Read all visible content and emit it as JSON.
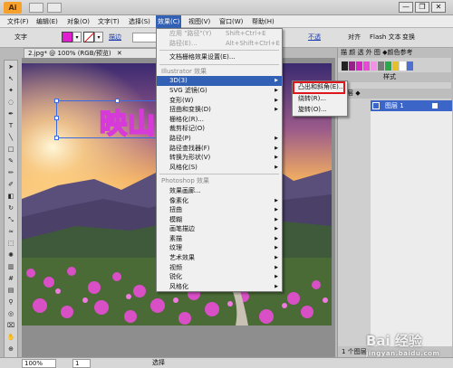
{
  "app": {
    "logo": "Ai"
  },
  "window_controls": {
    "minimize": "—",
    "restore": "❐",
    "close": "✕"
  },
  "menubar": {
    "items": [
      {
        "label": "文件(F)",
        "active": false
      },
      {
        "label": "编辑(E)",
        "active": false
      },
      {
        "label": "对象(O)",
        "active": false
      },
      {
        "label": "文字(T)",
        "active": false
      },
      {
        "label": "选择(S)",
        "active": false
      },
      {
        "label": "效果(C)",
        "active": true
      },
      {
        "label": "视图(V)",
        "active": false
      },
      {
        "label": "窗口(W)",
        "active": false
      },
      {
        "label": "帮助(H)",
        "active": false
      }
    ]
  },
  "control_bar": {
    "type_label": "文字",
    "fill_color": "#e020d0",
    "stroke_label": "描边",
    "opacity_label": "不透",
    "align_label": "对齐",
    "flash_label": "Flash 文本",
    "transform_label": "变换"
  },
  "document": {
    "tab_title": "2.jpg* @ 100% (RGB/预览)",
    "close": "✕",
    "artwork_text": "映山"
  },
  "effect_menu": {
    "items": [
      {
        "label": "应用 \"路径\"(Y)",
        "shortcut": "Shift+Ctrl+E",
        "type": "disabled"
      },
      {
        "label": "路径(E)...",
        "shortcut": "Alt+Shift+Ctrl+E",
        "type": "disabled"
      },
      {
        "type": "sep"
      },
      {
        "label": "文档栅格效果设置(E)...",
        "type": "item"
      },
      {
        "type": "sep"
      },
      {
        "label": "Illustrator 效果",
        "type": "section"
      },
      {
        "label": "3D(3)",
        "type": "hover",
        "submenu": true
      },
      {
        "label": "SVG 滤镜(G)",
        "type": "item",
        "submenu": true
      },
      {
        "label": "变形(W)",
        "type": "item",
        "submenu": true
      },
      {
        "label": "扭曲和变换(D)",
        "type": "item",
        "submenu": true
      },
      {
        "label": "栅格化(R)...",
        "type": "item"
      },
      {
        "label": "裁剪标记(O)",
        "type": "item"
      },
      {
        "label": "路径(P)",
        "type": "item",
        "submenu": true
      },
      {
        "label": "路径查找器(F)",
        "type": "item",
        "submenu": true
      },
      {
        "label": "转换为形状(V)",
        "type": "item",
        "submenu": true
      },
      {
        "label": "风格化(S)",
        "type": "item",
        "submenu": true
      },
      {
        "type": "sep"
      },
      {
        "label": "Photoshop 效果",
        "type": "section"
      },
      {
        "label": "效果画廊...",
        "type": "item"
      },
      {
        "label": "像素化",
        "type": "item",
        "submenu": true
      },
      {
        "label": "扭曲",
        "type": "item",
        "submenu": true
      },
      {
        "label": "模糊",
        "type": "item",
        "submenu": true
      },
      {
        "label": "画笔描边",
        "type": "item",
        "submenu": true
      },
      {
        "label": "素描",
        "type": "item",
        "submenu": true
      },
      {
        "label": "纹理",
        "type": "item",
        "submenu": true
      },
      {
        "label": "艺术效果",
        "type": "item",
        "submenu": true
      },
      {
        "label": "视频",
        "type": "item",
        "submenu": true
      },
      {
        "label": "锐化",
        "type": "item",
        "submenu": true
      },
      {
        "label": "风格化",
        "type": "item",
        "submenu": true
      }
    ]
  },
  "submenu_3d": {
    "items": [
      {
        "label": "凸出和斜角(E)..."
      },
      {
        "label": "绕转(R)..."
      },
      {
        "label": "旋转(O)..."
      }
    ]
  },
  "right_panel": {
    "tabs": "描 颜 透 外 图 ◆颜色参考",
    "tabs2": "样式",
    "layer_tabs": "图层 ◆",
    "layer_name": "图层 1",
    "footer": "1 个图层"
  },
  "status_bar": {
    "zoom": "100%",
    "page": "1",
    "mode": "选择"
  },
  "watermark": {
    "text": "Bai 经验",
    "sub": "jingyan.baidu.com"
  }
}
